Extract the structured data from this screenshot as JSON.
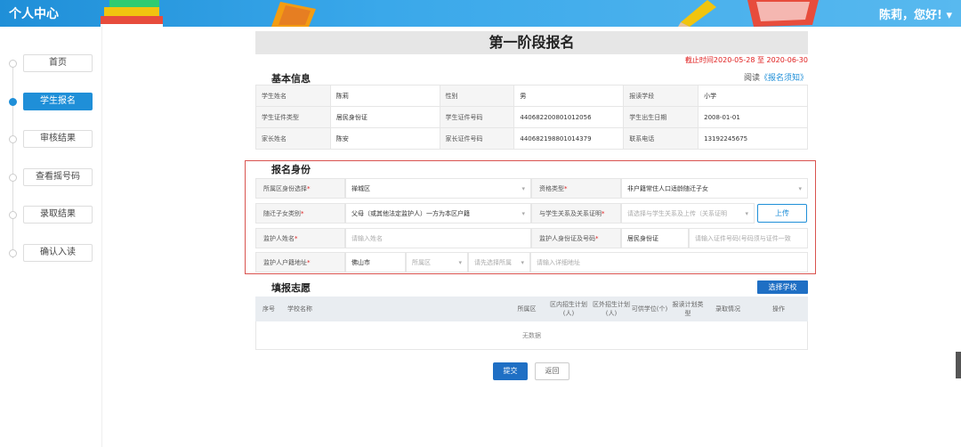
{
  "header": {
    "brand": "个人中心",
    "user_greeting": "陈莉，您好! ▾"
  },
  "sidebar": {
    "items": [
      {
        "label": "首页",
        "active": false
      },
      {
        "label": "学生报名",
        "active": true
      },
      {
        "label": "审核结果",
        "active": false
      },
      {
        "label": "查看摇号码",
        "active": false
      },
      {
        "label": "录取结果",
        "active": false
      },
      {
        "label": "确认入读",
        "active": false
      }
    ]
  },
  "page": {
    "title": "第一阶段报名",
    "deadline": "截止时间2020-05-28 至 2020-06-30",
    "basic_title": "基本信息",
    "read_prefix": "阅读",
    "read_link": "《报名须知》"
  },
  "basic_info": [
    [
      {
        "label": "学生姓名",
        "value": "陈莉"
      },
      {
        "label": "性别",
        "value": "男"
      },
      {
        "label": "报读学段",
        "value": "小学"
      }
    ],
    [
      {
        "label": "学生证件类型",
        "value": "居民身份证"
      },
      {
        "label": "学生证件号码",
        "value": "440682200801012056"
      },
      {
        "label": "学生出生日期",
        "value": "2008-01-01"
      }
    ],
    [
      {
        "label": "家长姓名",
        "value": "陈安"
      },
      {
        "label": "家长证件号码",
        "value": "440682198801014379"
      },
      {
        "label": "联系电话",
        "value": "13192245675"
      }
    ]
  ],
  "identity": {
    "title": "报名身份",
    "district_label": "所属区身份选择",
    "district_value": "禅城区",
    "qual_label": "资格类型",
    "qual_value": "非户籍常住人口适龄随迁子女",
    "child_type_label": "随迁子女类别",
    "child_type_value": "父母（或其他法定监护人）一方为本区户籍",
    "relation_label": "与学生关系及关系证明",
    "relation_placeholder": "请选择与学生关系及上传（关系证明",
    "upload_label": "上传",
    "guardian_name_label": "监护人姓名",
    "guardian_name_placeholder": "请输入姓名",
    "guardian_id_label": "监护人身份证及号码",
    "guardian_id_type": "居民身份证",
    "guardian_id_placeholder": "请输入证件号码(号码须与证件一致",
    "address_label": "监护人户籍地址",
    "address_city": "佛山市",
    "address_district_placeholder": "所属区",
    "address_street_placeholder": "请先选择所属",
    "address_detail_placeholder": "请输入详细地址"
  },
  "wish": {
    "title": "填报志愿",
    "select_school": "选择学校",
    "columns": [
      "序号",
      "学校名称",
      "所属区",
      "区内招生计划(人)",
      "区外招生计划(人)",
      "可供学位(个)",
      "报读计划类型",
      "录取情况",
      "操作"
    ],
    "empty_text": "无数据"
  },
  "actions": {
    "submit": "提交",
    "back": "返回"
  },
  "colors": {
    "primary": "#1f8fd8",
    "button": "#1f6fc4",
    "highlight_border": "#d9534f",
    "required": "#e02020"
  }
}
